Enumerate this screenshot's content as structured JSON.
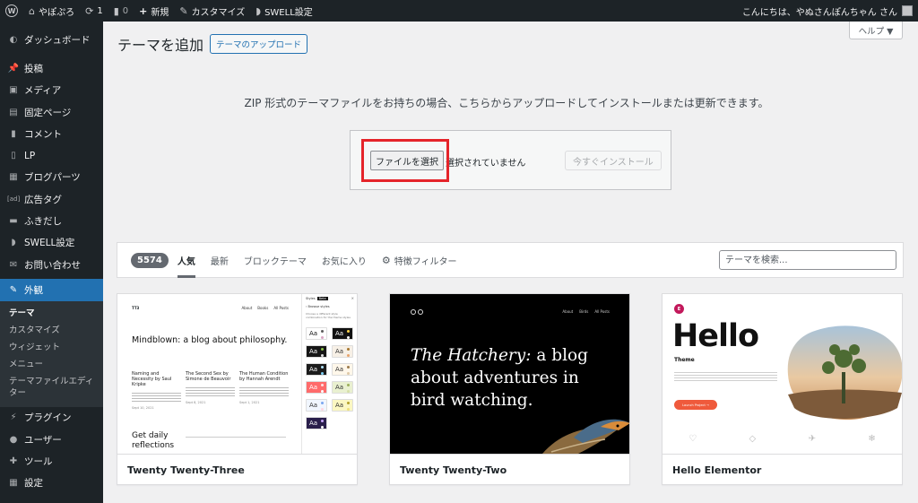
{
  "admin_bar": {
    "site_name": "やぽぷろ",
    "updates_count": "1",
    "comments_count": "0",
    "new_label": "新規",
    "customize_label": "カスタマイズ",
    "swell_label": "SWELL設定",
    "greeting": "こんにちは、やぬさんぽんちゃん さん"
  },
  "sidebar": {
    "dashboard": "ダッシュボード",
    "items_top": [
      {
        "label": "投稿",
        "icon": "pin-icon"
      },
      {
        "label": "メディア",
        "icon": "media-icon"
      },
      {
        "label": "固定ページ",
        "icon": "page-icon"
      },
      {
        "label": "コメント",
        "icon": "comment-icon"
      },
      {
        "label": "LP",
        "icon": "lp-icon"
      },
      {
        "label": "ブログパーツ",
        "icon": "blogparts-icon"
      },
      {
        "label": "広告タグ",
        "icon": "ad-tag-icon"
      },
      {
        "label": "ふきだし",
        "icon": "balloon-icon"
      },
      {
        "label": "SWELL設定",
        "icon": "swell-icon"
      },
      {
        "label": "お問い合わせ",
        "icon": "mail-icon"
      }
    ],
    "current": {
      "label": "外観",
      "icon": "appearance-icon"
    },
    "submenu": [
      "テーマ",
      "カスタマイズ",
      "ウィジェット",
      "メニュー",
      "テーマファイルエディター"
    ],
    "items_bottom": [
      {
        "label": "プラグイン",
        "icon": "plugin-icon"
      },
      {
        "label": "ユーザー",
        "icon": "user-icon"
      },
      {
        "label": "ツール",
        "icon": "tool-icon"
      },
      {
        "label": "設定",
        "icon": "settings-icon"
      }
    ]
  },
  "help_tab": "ヘルプ ▼",
  "page": {
    "title": "テーマを追加",
    "upload_button": "テーマのアップロード",
    "upload_help": "ZIP 形式のテーマファイルをお持ちの場合、こちらからアップロードしてインストールまたは更新できます。",
    "file_select": "ファイルを選択",
    "file_status": "選択されていません",
    "install_now": "今すぐインストール"
  },
  "filter": {
    "count": "5574",
    "tabs": [
      "人気",
      "最新",
      "ブロックテーマ",
      "お気に入り"
    ],
    "feature_filter": "特徴フィルター",
    "search_placeholder": "テーマを検索..."
  },
  "themes": [
    {
      "name": "Twenty Twenty-Three",
      "preview": {
        "site": "TT3",
        "nav": [
          "About",
          "Books",
          "All Posts"
        ],
        "headline": "Mindblown: a blog about philosophy.",
        "posts": [
          {
            "title": "Naming and Necessity by Saul Kripke",
            "date": "Sept 10, 2021"
          },
          {
            "title": "The Second Sex by Simone de Beauvoir",
            "date": "Sept 8, 2021"
          },
          {
            "title": "The Human Condition by Hannah Arendt",
            "date": "Sept 1, 2021"
          }
        ],
        "daily": "Get daily reflections",
        "panel_title": "Styles",
        "panel_tab": "Beta",
        "panel_sub": "‹ Browse styles",
        "panel_desc": "Choose a different style combination for the theme styles",
        "swatch_text": "Aa"
      }
    },
    {
      "name": "Twenty Twenty-Two",
      "preview": {
        "nav": [
          "About",
          "Birds",
          "All Posts"
        ],
        "headline_em": "The Hatchery:",
        "headline_rest": " a blog about adventures in bird watching."
      }
    },
    {
      "name": "Hello Elementor",
      "preview": {
        "badge": "E",
        "title": "Hello",
        "subtitle": "Theme",
        "cta": "Launch Project →",
        "icons": [
          "♡",
          "◇",
          "✈",
          "❄"
        ]
      }
    }
  ],
  "colors": {
    "admin_dark": "#1d2327",
    "accent_blue": "#2271b1",
    "highlight_red": "#e5242a"
  }
}
